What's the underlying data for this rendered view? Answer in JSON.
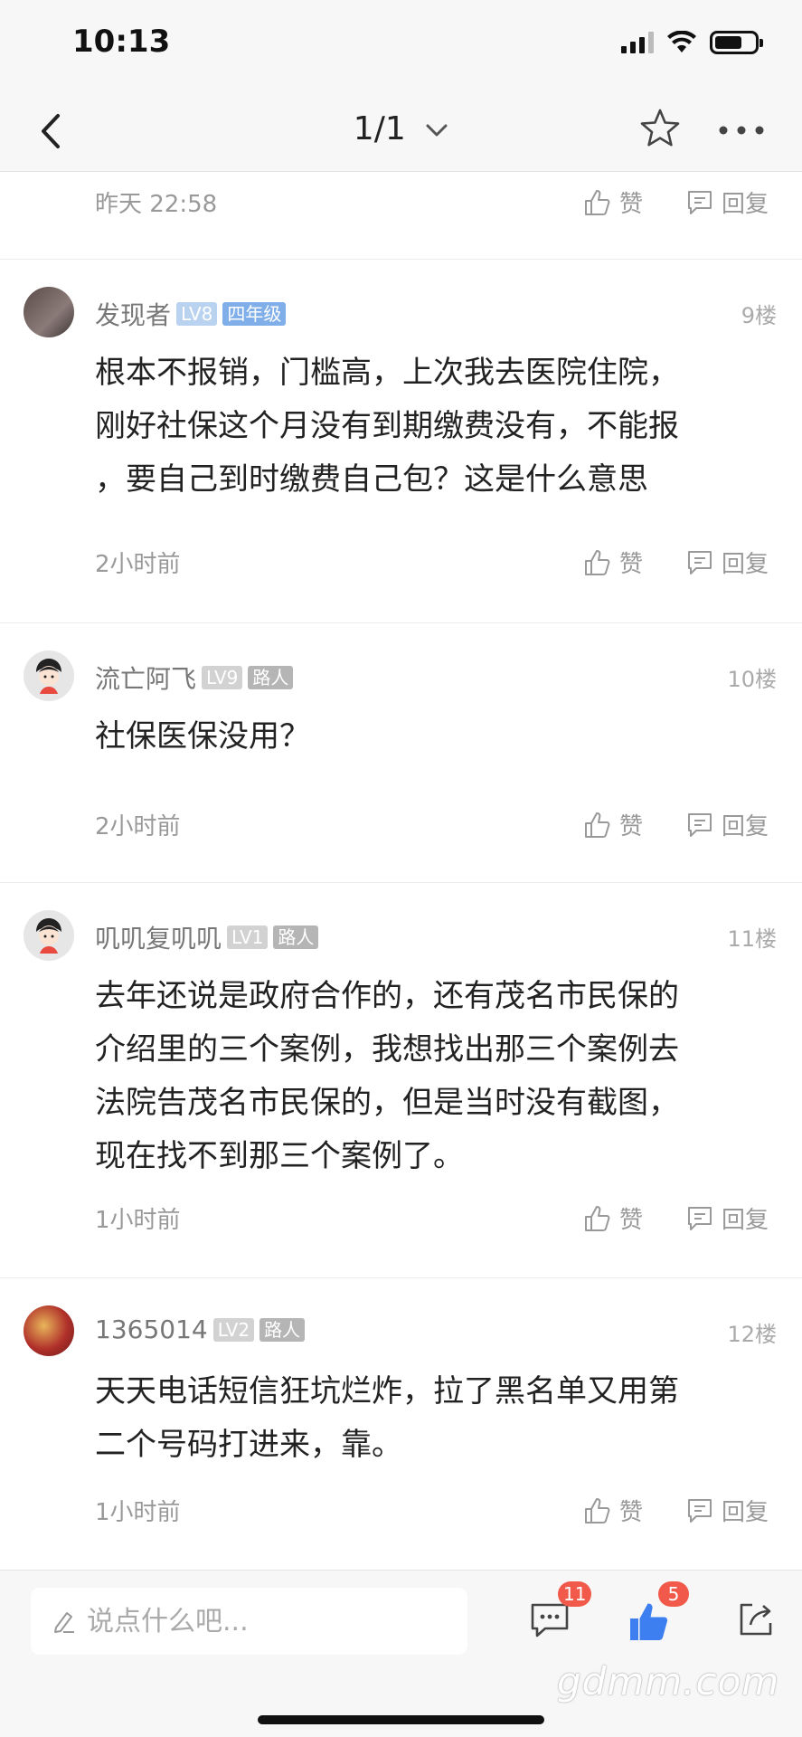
{
  "status_bar": {
    "time": "10:13"
  },
  "nav": {
    "page_indicator": "1/1"
  },
  "previous_comment": {
    "time": "昨天 22:58",
    "like_label": "赞",
    "reply_label": "回复"
  },
  "comments": [
    {
      "username": "发现者",
      "level": "LV8",
      "title": "四年级",
      "floor": "9楼",
      "lines": [
        "根本不报销，门槛高，上次我去医院住院，",
        "刚好社保这个月没有到期缴费没有，不能报",
        "，要自己到时缴费自己包？这是什么意思"
      ],
      "time": "2小时前",
      "like_label": "赞",
      "reply_label": "回复"
    },
    {
      "username": "流亡阿飞",
      "level": "LV9",
      "title": "路人",
      "floor": "10楼",
      "lines": [
        "社保医保没用？"
      ],
      "time": "2小时前",
      "like_label": "赞",
      "reply_label": "回复"
    },
    {
      "username": "叽叽复叽叽",
      "level": "LV1",
      "title": "路人",
      "floor": "11楼",
      "lines": [
        "去年还说是政府合作的，还有茂名市民保的",
        "介绍里的三个案例，我想找出那三个案例去",
        "法院告茂名市民保的，但是当时没有截图，",
        "现在找不到那三个案例了。"
      ],
      "time": "1小时前",
      "like_label": "赞",
      "reply_label": "回复"
    },
    {
      "username": "1365014",
      "level": "LV2",
      "title": "路人",
      "floor": "12楼",
      "lines": [
        "天天电话短信狂坑烂炸，拉了黑名单又用第",
        "二个号码打进来，靠。"
      ],
      "time": "1小时前",
      "like_label": "赞",
      "reply_label": "回复"
    }
  ],
  "bottom_bar": {
    "input_placeholder": "说点什么吧...",
    "comment_count": "11",
    "like_count": "5"
  },
  "watermark": "gdmm.com",
  "colors": {
    "accent_blue": "#3d7ff0",
    "badge_red": "#f15a4a"
  }
}
